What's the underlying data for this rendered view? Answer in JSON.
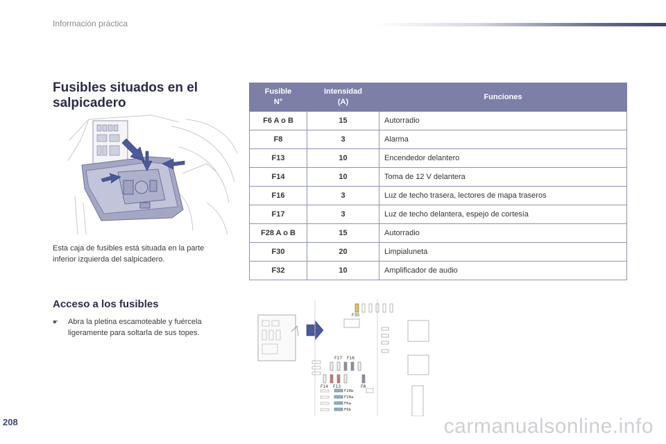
{
  "header": {
    "section": "Información práctica"
  },
  "title": {
    "line1": "Fusibles situados en el",
    "line2": "salpicadero"
  },
  "caption": {
    "line1": "Esta caja de fusibles está situada en la parte",
    "line2": "inferior izquierda del salpicadero."
  },
  "access": {
    "heading": "Acceso a los fusibles",
    "bullet": "☛",
    "step_line1": "Abra la pletina escamoteable y fuércela",
    "step_line2": "ligeramente para soltarla de sus topes."
  },
  "table": {
    "headers": {
      "fuse_line1": "Fusible",
      "fuse_line2": "N°",
      "intensity_line1": "Intensidad",
      "intensity_line2": "(A)",
      "functions": "Funciones"
    },
    "rows": [
      {
        "fuse": "F6 A o B",
        "amps": "15",
        "function": "Autorradio"
      },
      {
        "fuse": "F8",
        "amps": "3",
        "function": "Alarma"
      },
      {
        "fuse": "F13",
        "amps": "10",
        "function": "Encendedor delantero"
      },
      {
        "fuse": "F14",
        "amps": "10",
        "function": "Toma de 12 V delantera"
      },
      {
        "fuse": "F16",
        "amps": "3",
        "function": "Luz de techo trasera, lectores de mapa traseros"
      },
      {
        "fuse": "F17",
        "amps": "3",
        "function": "Luz de techo delantera, espejo de cortesía"
      },
      {
        "fuse": "F28 A o B",
        "amps": "15",
        "function": "Autorradio"
      },
      {
        "fuse": "F30",
        "amps": "20",
        "function": "Limpialuneta"
      },
      {
        "fuse": "F32",
        "amps": "10",
        "function": "Amplificador de audio"
      }
    ]
  },
  "diagram_labels": {
    "f30": "F30",
    "f17": "F17",
    "f16": "F16",
    "f14": "F14",
    "f13": "F13",
    "f8": "F8",
    "f28b": "F28b",
    "f28a": "F28a",
    "f6a": "F6a",
    "f6b": "F6b"
  },
  "footer": {
    "page_number": "208",
    "watermark": "carmanualsonline.info"
  },
  "colors": {
    "brand": "#3f4376",
    "table_header": "#7c7fa6",
    "arrow": "#4a5a9a"
  }
}
